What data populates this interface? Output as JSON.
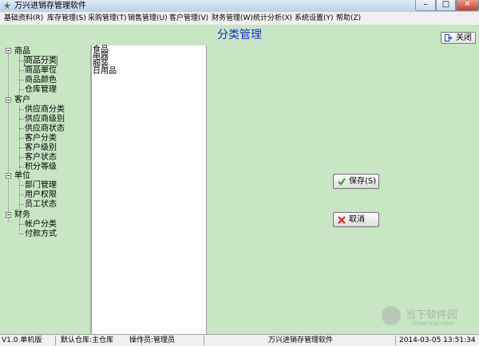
{
  "window": {
    "title": "万兴进销存管理软件",
    "buttons": {
      "minimize": "–",
      "maximize": "□",
      "close": "✕"
    }
  },
  "menu": [
    "基础资料(R)",
    "库存管理(S)",
    "采购管理(T)",
    "销售管理(U)",
    "客户管理(V)",
    "财务管理(W)",
    "统计分析(X)",
    "系统设置(Y)",
    "帮助(Z)"
  ],
  "header": {
    "title": "分类管理",
    "close_label": "关闭",
    "close_icon": "exit-icon"
  },
  "tree": {
    "groups": [
      {
        "label": "商品",
        "children": [
          "商品分类",
          "商品单位",
          "商品颜色",
          "仓库管理"
        ]
      },
      {
        "label": "客户",
        "children": [
          "供应商分类",
          "供应商级别",
          "供应商状态",
          "客户分类",
          "客户级别",
          "客户状态",
          "积分等级"
        ]
      },
      {
        "label": "单位",
        "children": [
          "部门管理",
          "用户权限",
          "员工状态"
        ]
      },
      {
        "label": "财务",
        "children": [
          "帐户分类",
          "付款方式"
        ]
      }
    ],
    "selected": "商品分类"
  },
  "category_list": [
    "食品",
    "电器",
    "服装",
    "日用品"
  ],
  "actions": {
    "save_label": "保存(S)",
    "cancel_label": "取消",
    "save_icon_color": "#2e9a2e",
    "cancel_icon_color": "#d62020"
  },
  "status": {
    "version": "V1.0 单机版",
    "warehouse": "默认仓库:主仓库",
    "operator": "操作员:管理员",
    "app_name": "万兴进销存管理软件",
    "datetime": "2014-03-05  13:51:34"
  },
  "watermark": {
    "text": "当下软件园",
    "sub": "downxia.com"
  },
  "colors": {
    "background": "#c8e6c4",
    "title_blue": "#1a2fd0"
  }
}
